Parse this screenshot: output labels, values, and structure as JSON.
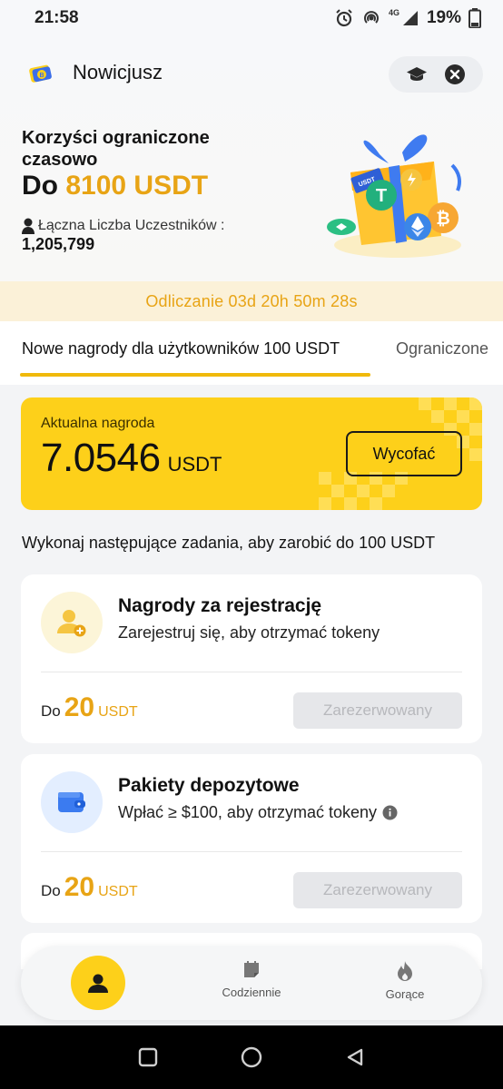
{
  "status_bar": {
    "time": "21:58",
    "network": "4G",
    "battery": "19%"
  },
  "header": {
    "title": "Nowicjusz",
    "icons": [
      "graduation-cap-icon",
      "close-icon"
    ]
  },
  "hero": {
    "subtitle": "Korzyści ograniczone czasowo",
    "amount_prefix": "Do ",
    "amount_value": "8100 USDT",
    "participants_label": "Łączna Liczba Uczestników :",
    "participants_count": "1,205,799"
  },
  "countdown": {
    "text": "Odliczanie 03d 20h 50m 28s"
  },
  "tabs": [
    {
      "label": "Nowe nagrody dla użytkowników 100 USDT",
      "active": true
    },
    {
      "label": "Ograniczone",
      "active": false
    }
  ],
  "reward_card": {
    "label": "Aktualna nagroda",
    "value": "7.0546",
    "unit": "USDT",
    "withdraw_label": "Wycofać"
  },
  "tasks_intro": "Wykonaj następujące zadania, aby zarobić do 100 USDT",
  "tasks": [
    {
      "title": "Nagrody za rejestrację",
      "description": "Zarejestruj się, aby otrzymać tokeny",
      "reward_prefix": "Do",
      "reward_value": "20",
      "reward_unit": "USDT",
      "button_label": "Zarezerwowany",
      "icon": "user-add-icon"
    },
    {
      "title": "Pakiety depozytowe",
      "description": "Wpłać ≥ $100, aby otrzymać tokeny",
      "reward_prefix": "Do",
      "reward_value": "20",
      "reward_unit": "USDT",
      "button_label": "Zarezerwowany",
      "icon": "wallet-icon"
    }
  ],
  "bottom_nav": [
    {
      "label": "",
      "icon": "user-icon",
      "active": true
    },
    {
      "label": "Codziennie",
      "icon": "calendar-note-icon",
      "active": false
    },
    {
      "label": "Gorące",
      "icon": "flame-icon",
      "active": false
    }
  ],
  "colors": {
    "brand_yellow": "#fdd01a",
    "accent_gold": "#e8a415",
    "countdown_bg": "#fbf1d8",
    "disabled_bg": "#e6e7ea"
  }
}
